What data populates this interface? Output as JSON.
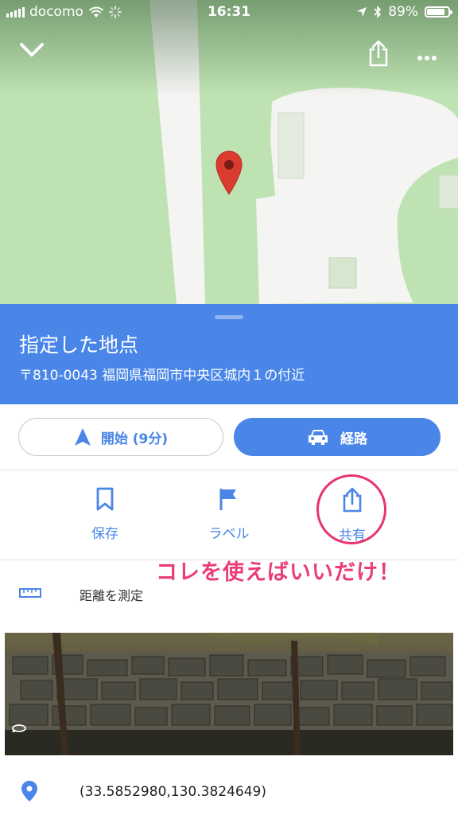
{
  "status_bar": {
    "carrier": "docomo",
    "time": "16:31",
    "battery_percent": "89%"
  },
  "place": {
    "title": "指定した地点",
    "address": "〒810-0043 福岡県福岡市中央区城内１の付近"
  },
  "buttons": {
    "start_label": "開始 (9分)",
    "route_label": "経路"
  },
  "actions": [
    {
      "label": "保存",
      "icon": "bookmark-icon"
    },
    {
      "label": "ラベル",
      "icon": "flag-icon"
    },
    {
      "label": "共有",
      "icon": "share-icon"
    }
  ],
  "annotation": "コレを使えばいいだけ！",
  "measure": {
    "label": "距離を測定",
    "icon": "ruler-icon"
  },
  "coordinates": "(33.5852980,130.3824649)",
  "colors": {
    "accent": "#4a86e8",
    "annotation": "#ea3d7a",
    "map_green": "#bfe2b3",
    "pin_red": "#db3c30"
  }
}
